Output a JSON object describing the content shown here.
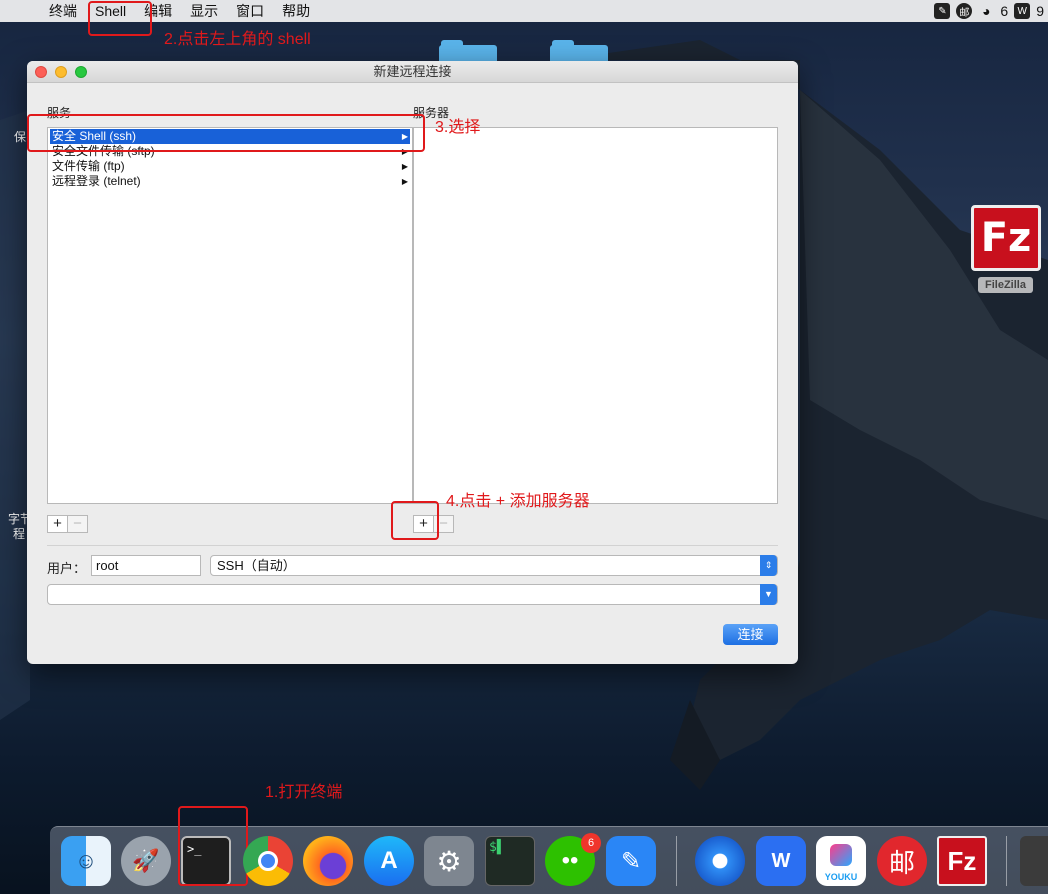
{
  "menubar": {
    "items": [
      "终端",
      "Shell",
      "编辑",
      "显示",
      "窗口",
      "帮助"
    ],
    "status_count": "6",
    "status_trailing": "9"
  },
  "annotations": {
    "step1": "1.打开终端",
    "step2": "2.点击左上角的 shell",
    "step3": "3.选择",
    "step4": "4.点击 + 添加服务器"
  },
  "desktop": {
    "left_text_top": "保",
    "left_text_mid1": "字节",
    "left_text_mid2": "程",
    "filezilla_label": "FileZilla",
    "filezilla_glyph": "Fz"
  },
  "window": {
    "title": "新建远程连接",
    "services_label": "服务",
    "servers_label": "服务器",
    "services": [
      {
        "label": "安全 Shell (ssh)",
        "selected": true
      },
      {
        "label": "安全文件传输 (sftp)",
        "selected": false
      },
      {
        "label": "文件传输 (ftp)",
        "selected": false
      },
      {
        "label": "远程登录 (telnet)",
        "selected": false
      }
    ],
    "plus": "+",
    "minus": "−",
    "user_label": "用户：",
    "user_value": "root",
    "protocol_value": "SSH（自动）",
    "address_value": "",
    "connect_label": "连接"
  },
  "dock": {
    "wechat_badge": "6",
    "items": [
      "finder-icon",
      "launchpad-icon",
      "terminal-icon",
      "chrome-icon",
      "firefox-icon",
      "app-store-icon",
      "system-preferences-icon",
      "iterm-icon",
      "wechat-icon",
      "notes-icon",
      "safari-icon",
      "wps-icon",
      "youku-icon",
      "mail-icon",
      "filezilla-icon"
    ]
  },
  "colors": {
    "annotation_red": "#e0191b",
    "selection_blue": "#1861d8",
    "button_blue": "#1d6fe3"
  }
}
